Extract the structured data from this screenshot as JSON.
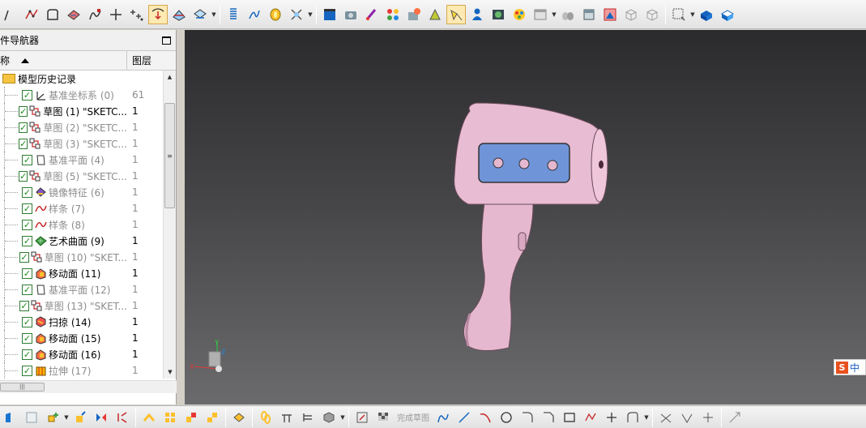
{
  "navigator": {
    "title": "件导航器",
    "col_name": "称",
    "col_layer": "图层",
    "root_label": "模型历史记录",
    "items": [
      {
        "label": "基准坐标系 (0)",
        "layer": "61",
        "dim": true,
        "icon": "datum-csys-icon"
      },
      {
        "label": "草图 (1) \"SKETC...",
        "layer": "1",
        "dim": false,
        "icon": "sketch-icon"
      },
      {
        "label": "草图 (2) \"SKETC...",
        "layer": "1",
        "dim": true,
        "icon": "sketch-icon"
      },
      {
        "label": "草图 (3) \"SKETC...",
        "layer": "1",
        "dim": true,
        "icon": "sketch-icon"
      },
      {
        "label": "基准平面 (4)",
        "layer": "1",
        "dim": true,
        "icon": "datum-plane-icon"
      },
      {
        "label": "草图 (5) \"SKETC...",
        "layer": "1",
        "dim": true,
        "icon": "sketch-icon"
      },
      {
        "label": "镜像特征 (6)",
        "layer": "1",
        "dim": true,
        "icon": "mirror-feature-icon"
      },
      {
        "label": "样条 (7)",
        "layer": "1",
        "dim": true,
        "icon": "spline-icon"
      },
      {
        "label": "样条 (8)",
        "layer": "1",
        "dim": true,
        "icon": "spline-icon"
      },
      {
        "label": "艺术曲面 (9)",
        "layer": "1",
        "dim": false,
        "icon": "studio-surface-icon"
      },
      {
        "label": "草图 (10) \"SKET...",
        "layer": "1",
        "dim": true,
        "icon": "sketch-icon"
      },
      {
        "label": "移动面 (11)",
        "layer": "1",
        "dim": false,
        "icon": "move-face-icon"
      },
      {
        "label": "基准平面 (12)",
        "layer": "1",
        "dim": true,
        "icon": "datum-plane-icon"
      },
      {
        "label": "草图 (13) \"SKET...",
        "layer": "1",
        "dim": true,
        "icon": "sketch-icon"
      },
      {
        "label": "扫掠 (14)",
        "layer": "1",
        "dim": false,
        "icon": "sweep-icon"
      },
      {
        "label": "移动面 (15)",
        "layer": "1",
        "dim": false,
        "icon": "move-face-icon"
      },
      {
        "label": "移动面 (16)",
        "layer": "1",
        "dim": false,
        "icon": "move-face-icon"
      },
      {
        "label": "拉伸 (17)",
        "layer": "1",
        "dim": true,
        "icon": "extrude-icon"
      }
    ]
  },
  "bottom_toolbar": {
    "finish_sketch_label": "完成草图"
  },
  "ime": {
    "label": "中"
  },
  "colors": {
    "model_body": "#e6b8d0",
    "panel_blue": "#6f94d8",
    "viewport_top": "#2b2b2d",
    "viewport_bottom": "#6b6b6d",
    "check_green": "#1b8a1b"
  }
}
